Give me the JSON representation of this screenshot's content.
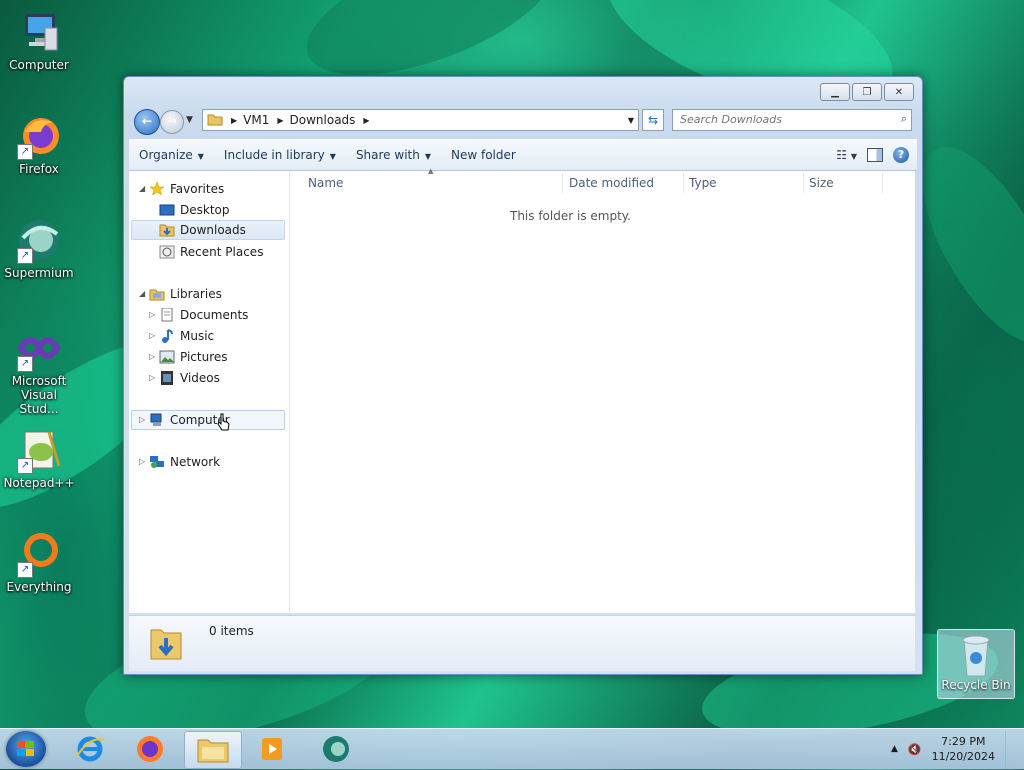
{
  "desktop": {
    "icons": [
      {
        "label": "Computer"
      },
      {
        "label": "Firefox"
      },
      {
        "label": "Supermium"
      },
      {
        "label": "Microsoft Visual Stud..."
      },
      {
        "label": "Notepad++"
      },
      {
        "label": "Everything"
      }
    ],
    "recycle_bin": {
      "label": "Recycle Bin"
    }
  },
  "window": {
    "address": {
      "crumbs": [
        "VM1",
        "Downloads"
      ]
    },
    "search": {
      "placeholder": "Search Downloads"
    },
    "toolbar": {
      "organize": "Organize",
      "include_in_library": "Include in library",
      "share_with": "Share with",
      "new_folder": "New folder"
    },
    "nav": {
      "favorites": "Favorites",
      "desktop": "Desktop",
      "downloads": "Downloads",
      "recent_places": "Recent Places",
      "libraries": "Libraries",
      "documents": "Documents",
      "music": "Music",
      "pictures": "Pictures",
      "videos": "Videos",
      "computer": "Computer",
      "network": "Network"
    },
    "columns": {
      "name": "Name",
      "date_modified": "Date modified",
      "type": "Type",
      "size": "Size"
    },
    "empty_message": "This folder is empty.",
    "details": {
      "item_count": "0 items"
    }
  },
  "taskbar": {
    "apps": [
      "internet-explorer",
      "firefox",
      "explorer",
      "media-player",
      "supermium"
    ],
    "clock": {
      "time": "7:29 PM",
      "date": "11/20/2024"
    }
  }
}
